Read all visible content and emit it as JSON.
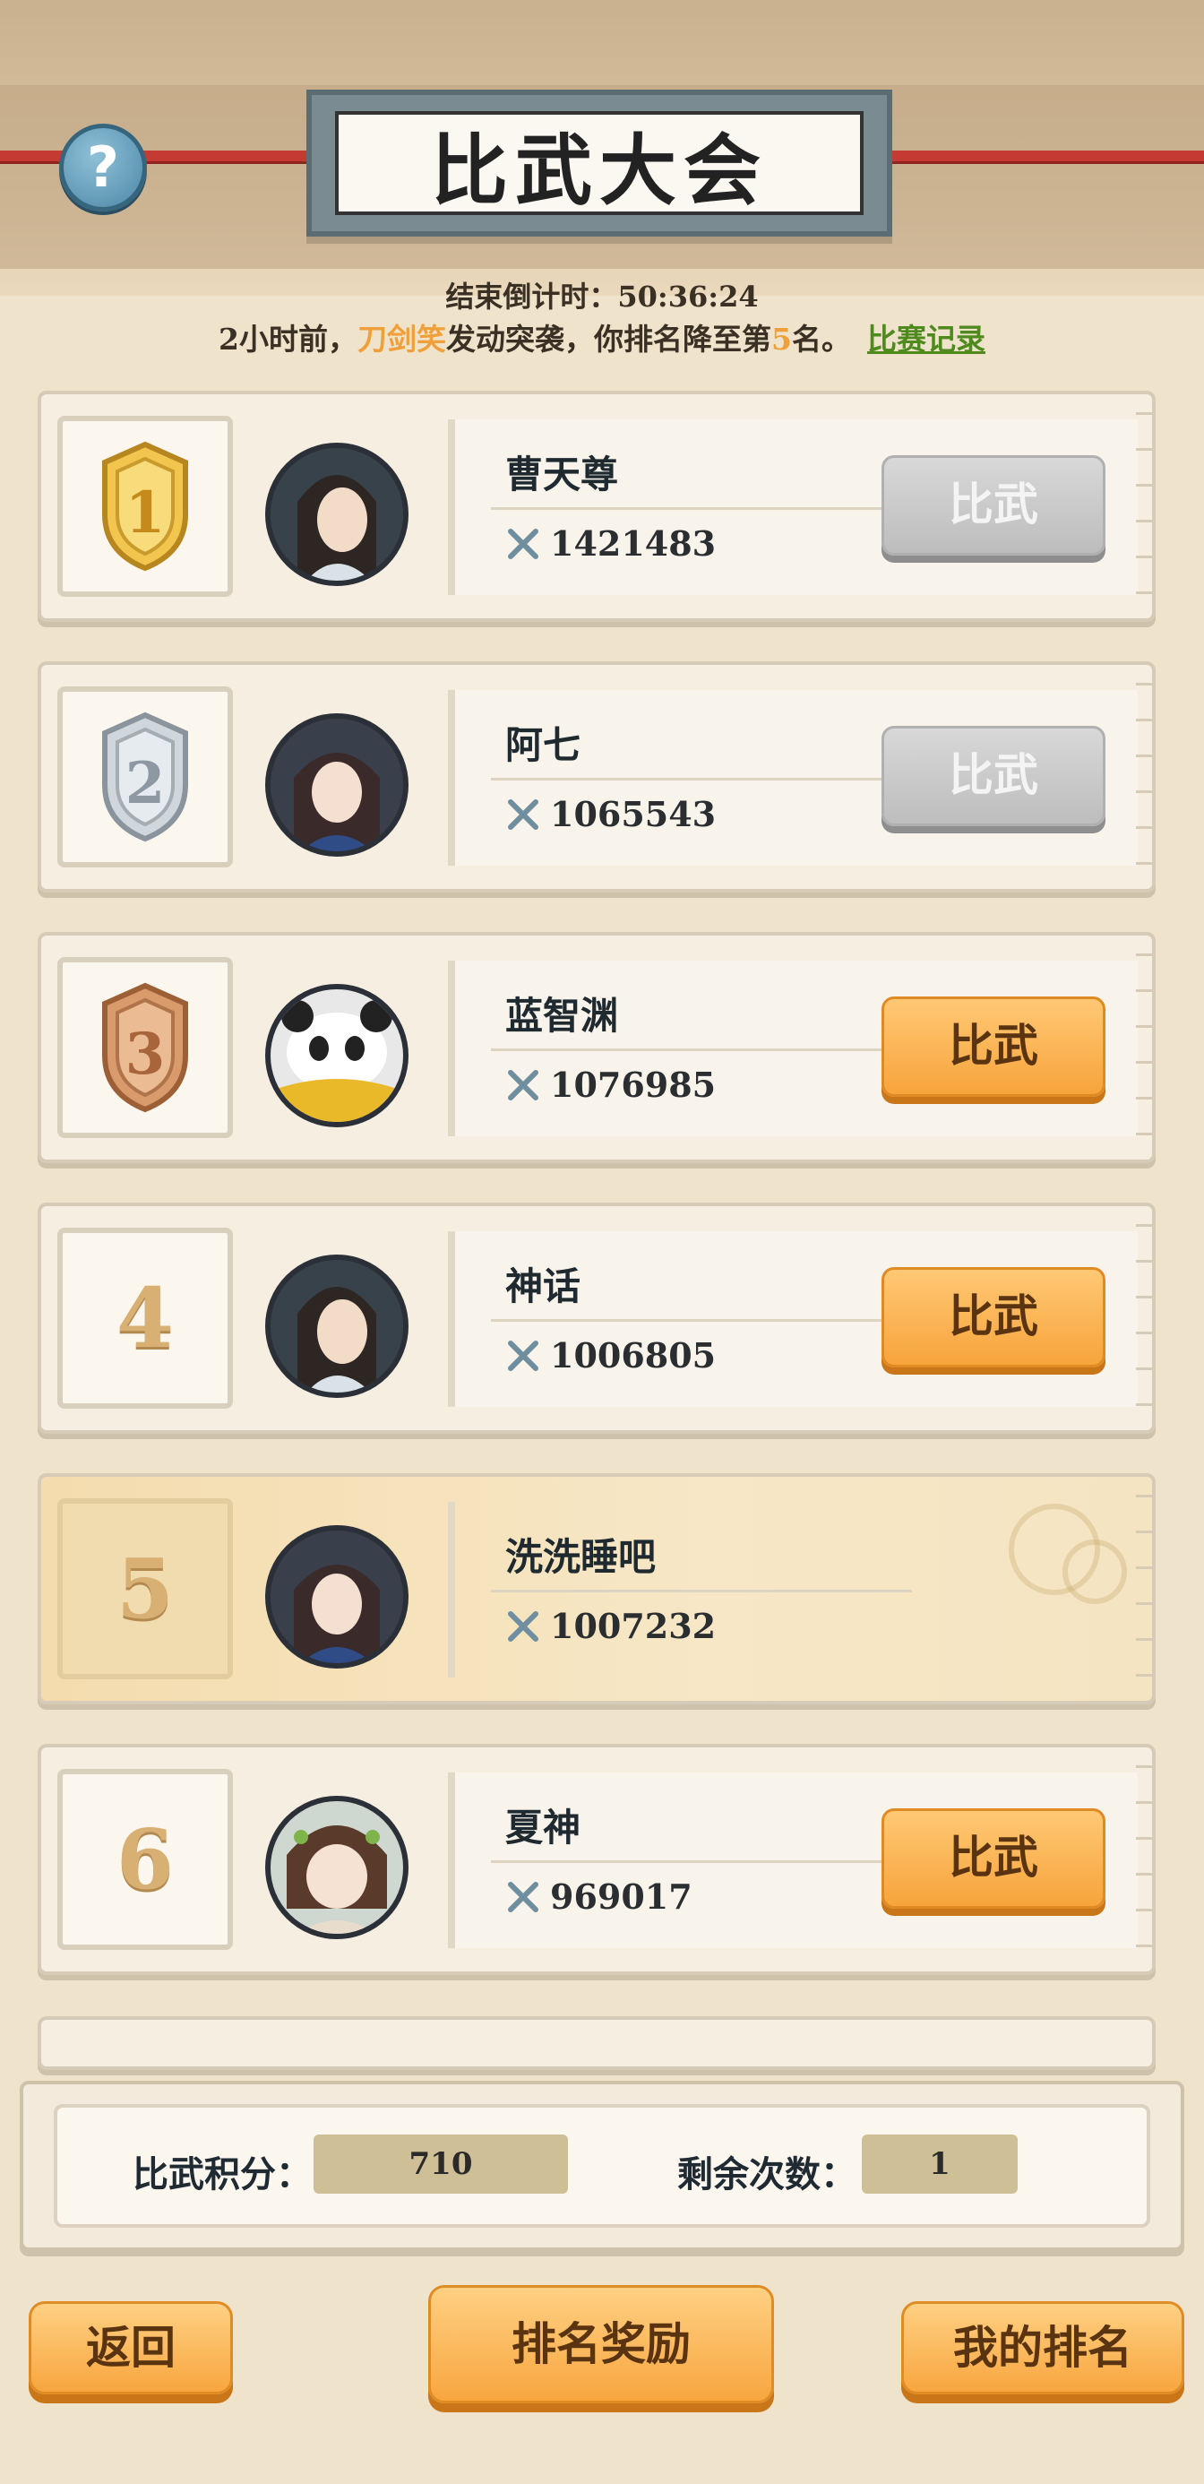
{
  "header": {
    "title": "比武大会",
    "help_glyph": "?",
    "countdown": "结束倒计时：50:36:24",
    "notice_prefix": "2小时前，",
    "notice_attacker": "刀剑笑",
    "notice_mid": "发动突袭，你排名降至第",
    "notice_rank": "5",
    "notice_suffix": "名。",
    "history_link": "比赛记录"
  },
  "fight_label": "比武",
  "rankings": [
    {
      "rank": "1",
      "name": "曹天尊",
      "power": "1421483",
      "button_state": "disabled",
      "badge": "gold-medal"
    },
    {
      "rank": "2",
      "name": "阿七",
      "power": "1065543",
      "button_state": "disabled",
      "badge": "silver-medal"
    },
    {
      "rank": "3",
      "name": "蓝智渊",
      "power": "1076985",
      "button_state": "active",
      "badge": "bronze-medal"
    },
    {
      "rank": "4",
      "name": "神话",
      "power": "1006805",
      "button_state": "active",
      "badge": "number"
    },
    {
      "rank": "5",
      "name": "洗洗睡吧",
      "power": "1007232",
      "button_state": "none",
      "badge": "number",
      "is_self": true
    },
    {
      "rank": "6",
      "name": "夏神",
      "power": "969017",
      "button_state": "active",
      "badge": "number"
    }
  ],
  "footer": {
    "points_label": "比武积分：",
    "points_value": "710",
    "remaining_label": "剩余次数：",
    "remaining_value": "1"
  },
  "actions": {
    "back": "返回",
    "rank_rewards": "排名奖励",
    "my_rank": "我的排名"
  },
  "colors": {
    "accent_orange": "#f8a63f",
    "highlight_text": "#f0a03a",
    "link_green": "#4e8a1e",
    "disabled_gray": "#bdbdbd"
  }
}
